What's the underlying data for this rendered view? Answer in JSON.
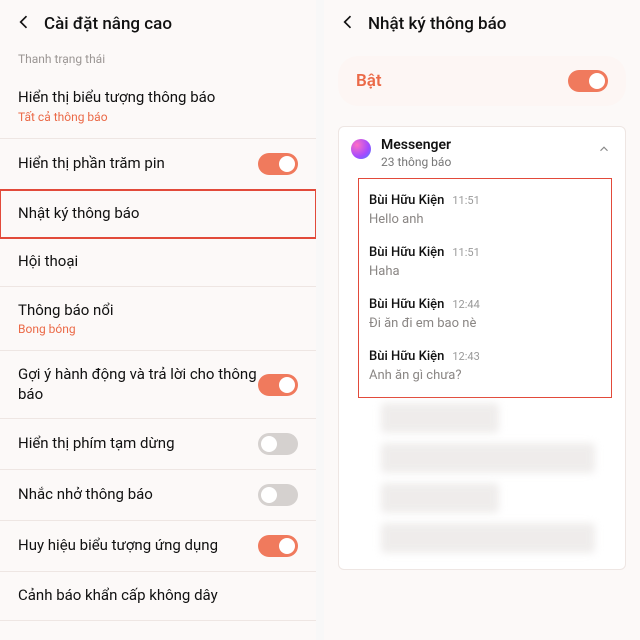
{
  "colors": {
    "accent": "#eb6a48"
  },
  "left": {
    "title": "Cài đặt nâng cao",
    "section": "Thanh trạng thái",
    "rows": [
      {
        "title": "Hiển thị biểu tượng thông báo",
        "sub": "Tất cả thông báo",
        "toggle": null
      },
      {
        "title": "Hiển thị phần trăm pin",
        "sub": "",
        "toggle": "on"
      },
      {
        "title": "Nhật ký thông báo",
        "sub": "",
        "toggle": null,
        "highlighted": true
      },
      {
        "title": "Hội thoại",
        "sub": "",
        "toggle": null
      },
      {
        "title": "Thông báo nổi",
        "sub": "Bong bóng",
        "toggle": null
      },
      {
        "title": "Gợi ý hành động và trả lời cho thông báo",
        "sub": "",
        "toggle": "on"
      },
      {
        "title": "Hiển thị phím tạm dừng",
        "sub": "",
        "toggle": "off"
      },
      {
        "title": "Nhắc nhở thông báo",
        "sub": "",
        "toggle": "off"
      },
      {
        "title": "Huy hiệu biểu tượng ứng dụng",
        "sub": "",
        "toggle": "on"
      },
      {
        "title": "Cảnh báo khẩn cấp không dây",
        "sub": "",
        "toggle": null
      }
    ]
  },
  "right": {
    "title": "Nhật ký thông báo",
    "master": {
      "label": "Bật",
      "state": "on"
    },
    "app": {
      "name": "Messenger",
      "count": "23 thông báo"
    },
    "notifs": [
      {
        "sender": "Bùi Hữu Kiện",
        "time": "11:51",
        "msg": "Hello anh"
      },
      {
        "sender": "Bùi Hữu Kiện",
        "time": "11:51",
        "msg": "Haha"
      },
      {
        "sender": "Bùi Hữu Kiện",
        "time": "12:44",
        "msg": "Đi ăn đi em bao nè"
      },
      {
        "sender": "Bùi Hữu Kiện",
        "time": "12:43",
        "msg": "Anh ăn gì chưa?"
      }
    ]
  }
}
